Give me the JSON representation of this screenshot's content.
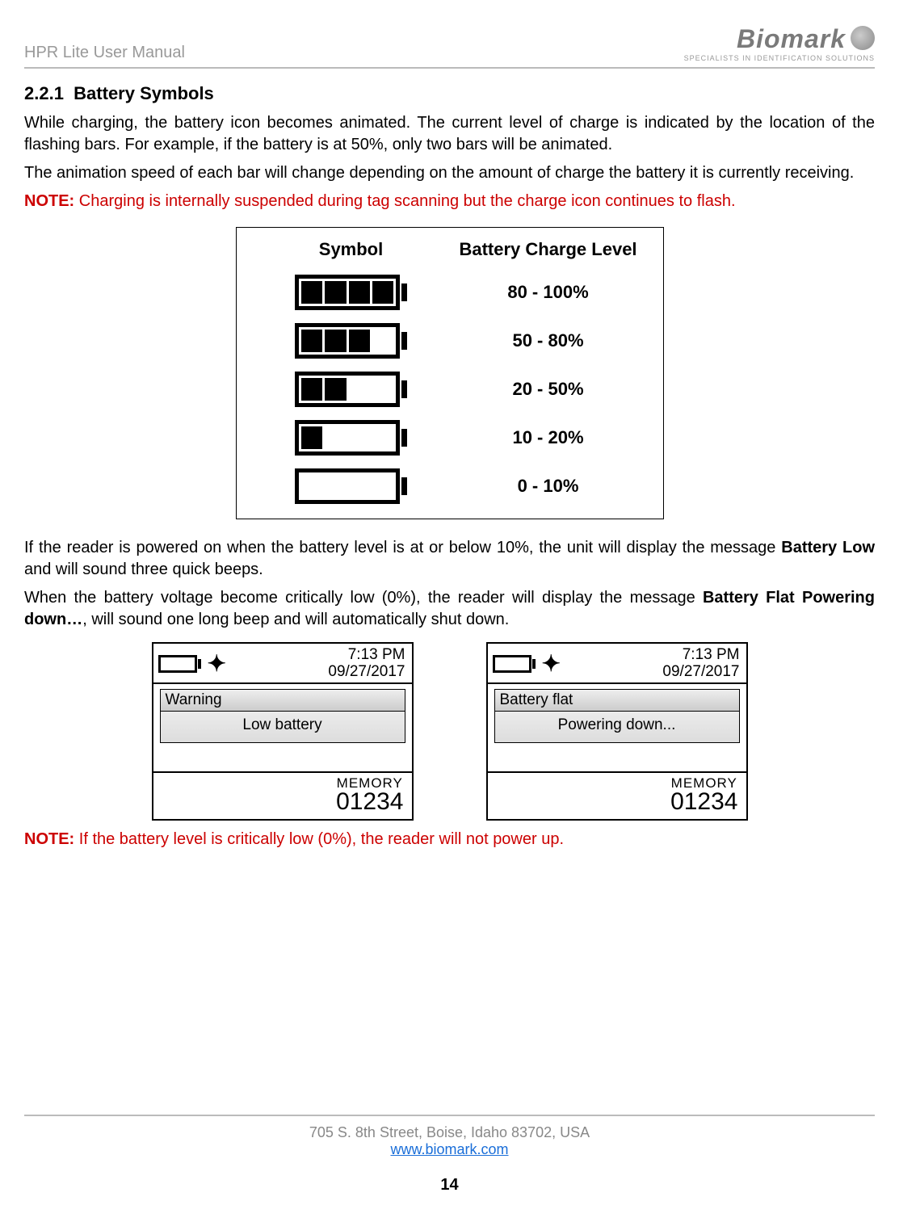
{
  "header": {
    "title": "HPR Lite User Manual",
    "logo_main": "Biomark",
    "logo_sub": "SPECIALISTS IN IDENTIFICATION SOLUTIONS"
  },
  "section": {
    "number": "2.2.1",
    "title": "Battery Symbols"
  },
  "para1": "While charging, the battery icon becomes animated. The current level of charge is indicated by the location of the flashing bars. For example, if the battery is at 50%, only two bars will be animated.",
  "para2": "The animation speed of each bar will change depending on the amount of charge the battery it is currently receiving.",
  "note1_prefix": "NOTE:",
  "note1_body": " Charging is internally suspended during tag scanning but the charge icon continues to flash.",
  "table": {
    "header_symbol": "Symbol",
    "header_level": "Battery Charge Level",
    "rows": [
      {
        "bars": 4,
        "level": "80 - 100%"
      },
      {
        "bars": 3,
        "level": "50 - 80%"
      },
      {
        "bars": 2,
        "level": "20 - 50%"
      },
      {
        "bars": 1,
        "level": "10 - 20%"
      },
      {
        "bars": 0,
        "level": "0 - 10%"
      }
    ]
  },
  "para3_a": "If the reader is powered on when the battery level is at or below 10%, the unit will display the message ",
  "para3_b": "Battery Low",
  "para3_c": " and will sound three quick beeps.",
  "para4_a": "When the battery voltage become critically low (0%), the reader will display the message ",
  "para4_b": "Battery Flat Powering down…",
  "para4_c": ", will sound one long beep and will automatically shut down.",
  "screen_time": "7:13 PM",
  "screen_date": "09/27/2017",
  "screen1": {
    "title": "Warning",
    "body": "Low battery"
  },
  "screen2": {
    "title": "Battery flat",
    "body": "Powering down..."
  },
  "memory_label": "MEMORY",
  "memory_value": "01234",
  "note2_prefix": "NOTE:",
  "note2_body": " If the battery level is critically low (0%), the reader will not power up.",
  "footer": {
    "address": "705 S. 8th Street, Boise, Idaho 83702, USA",
    "link": "www.biomark.com",
    "page": "14"
  }
}
